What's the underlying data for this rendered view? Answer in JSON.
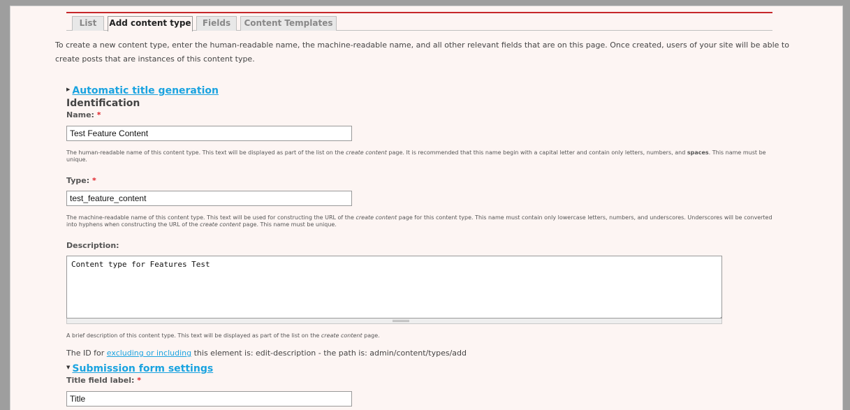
{
  "tabs": [
    {
      "label": "List",
      "active": false
    },
    {
      "label": "Add content type",
      "active": true
    },
    {
      "label": "Fields",
      "active": false
    },
    {
      "label": "Content Templates",
      "active": false
    }
  ],
  "intro_text": "To create a new content type, enter the human-readable name, the machine-readable name, and all other relevant fields that are on this page. Once created, users of your site will be able to create posts that are instances of this content type.",
  "auto_title": {
    "label": "Automatic title generation",
    "expanded": false
  },
  "identification": {
    "heading": "Identification",
    "name": {
      "label": "Name:",
      "required_mark": "*",
      "value": "Test Feature Content",
      "help_part1": "The human-readable name of this content type. This text will be displayed as part of the list on the ",
      "help_em": "create content",
      "help_part2": " page. It is recommended that this name begin with a capital letter and contain only letters, numbers, and ",
      "help_strong": "spaces",
      "help_part3": ". This name must be unique."
    },
    "type": {
      "label": "Type:",
      "required_mark": "*",
      "value": "test_feature_content",
      "help_part1": "The machine-readable name of this content type. This text will be used for constructing the URL of the ",
      "help_em1": "create content",
      "help_part2": " page for this content type. This name must contain only lowercase letters, numbers, and underscores. Underscores will be converted into hyphens when constructing the URL of the ",
      "help_em2": "create content",
      "help_part3": " page. This name must be unique."
    }
  },
  "description": {
    "label": "Description:",
    "value": "Content type for Features Test",
    "help_part1": "A brief description of this content type. This text will be displayed as part of the list on the ",
    "help_em": "create content",
    "help_part2": " page."
  },
  "id_line": {
    "prefix": "The ID for ",
    "link": "excluding or including",
    "suffix": " this element is: edit-description - the path is: admin/content/types/add"
  },
  "submission": {
    "label": "Submission form settings",
    "expanded": true
  },
  "title_field": {
    "label": "Title field label:",
    "required_mark": "*",
    "value": "Title"
  },
  "colors": {
    "accent_link": "#1aa3e0",
    "required": "#e0242b",
    "top_bar": "#c6282b",
    "page_bg": "#fdf5f3"
  },
  "icons": {
    "collapsed": "triangle-right-icon",
    "expanded": "triangle-down-icon"
  }
}
